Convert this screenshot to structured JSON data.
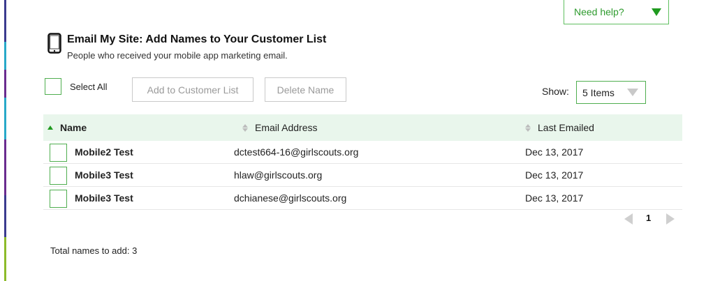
{
  "help": {
    "label": "Need help?",
    "icon": "triangle-down-icon",
    "accent": "#1f9a1f"
  },
  "header": {
    "icon": "mobile-phone-icon",
    "title": "Email My Site: Add Names to Your Customer List",
    "subtitle": "People who received your mobile app marketing email."
  },
  "toolbar": {
    "select_all_label": "Select All",
    "add_label": "Add to Customer List",
    "delete_label": "Delete Name",
    "show_label": "Show:",
    "show_value": "5 Items"
  },
  "table": {
    "columns": [
      "Name",
      "Email Address",
      "Last Emailed"
    ],
    "sorted_column": "Name",
    "header_bg": "#e9f6ec",
    "rows": [
      {
        "name": "Mobile2 Test",
        "email": "dctest664-16@girlscouts.org",
        "date": "Dec 13, 2017"
      },
      {
        "name": "Mobile3 Test",
        "email": "hlaw@girlscouts.org",
        "date": "Dec 13, 2017"
      },
      {
        "name": "Mobile3 Test",
        "email": "dchianese@girlscouts.org",
        "date": "Dec 13, 2017"
      }
    ]
  },
  "pagination": {
    "current_page": "1"
  },
  "footer": {
    "total": "Total names to add: 3"
  }
}
